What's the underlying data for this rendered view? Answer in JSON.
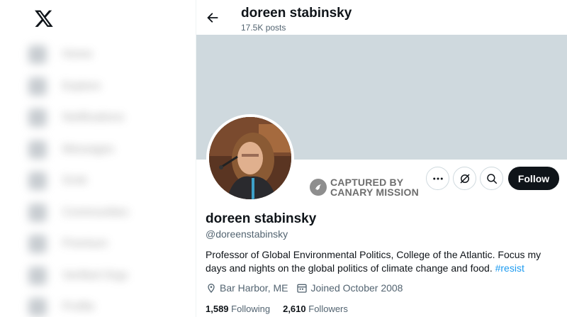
{
  "sidebar": {
    "logo": "x-logo-icon",
    "items": [
      {
        "icon": "home-icon",
        "label": "Home"
      },
      {
        "icon": "explore-icon",
        "label": "Explore"
      },
      {
        "icon": "notifications-icon",
        "label": "Notifications"
      },
      {
        "icon": "messages-icon",
        "label": "Messages"
      },
      {
        "icon": "grok-icon",
        "label": "Grok"
      },
      {
        "icon": "communities-icon",
        "label": "Communities"
      },
      {
        "icon": "premium-icon",
        "label": "Premium"
      },
      {
        "icon": "verified-orgs-icon",
        "label": "Verified Orgs"
      },
      {
        "icon": "profile-icon",
        "label": "Profile"
      }
    ]
  },
  "header": {
    "name": "doreen stabinsky",
    "posts": "17.5K posts"
  },
  "watermark": {
    "line1": "CAPTURED BY",
    "line2": "CANARY MISSION"
  },
  "actions": {
    "follow_label": "Follow"
  },
  "profile": {
    "display_name": "doreen stabinsky",
    "handle": "@doreenstabinsky",
    "bio_text": "Professor of Global Environmental Politics, College of the Atlantic. Focus my days and nights on the global politics of climate change and food. ",
    "bio_hashtag": "#resist",
    "location": "Bar Harbor, ME",
    "joined": "Joined October 2008",
    "following_count": "1,589",
    "following_label": "Following",
    "followers_count": "2,610",
    "followers_label": "Followers"
  },
  "colors": {
    "banner": "#cfd9de",
    "accent": "#1d9bf0",
    "follow_bg": "#0f1419"
  }
}
